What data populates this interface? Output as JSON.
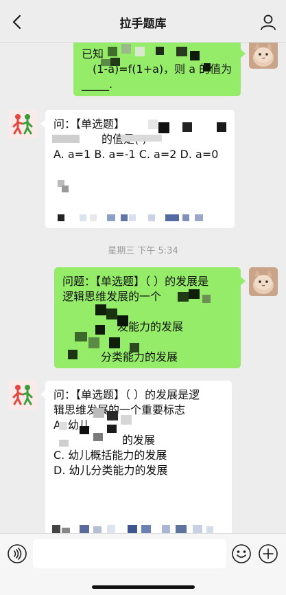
{
  "nav": {
    "title": "拉手题库"
  },
  "messages": {
    "m1": {
      "lines": [
        "已知",
        "(1-a)=f(1+a)，则 a 的值为",
        "_____."
      ]
    },
    "m2": {
      "lines": [
        "问：【单选题】",
        "的值是( )",
        "A. a=1 B. a=-1 C. a=2 D. a=0"
      ]
    },
    "timestamp": "星期三 下午 5:34",
    "m3": {
      "lines": [
        "问题：【单选题】（ ）的发展是",
        "逻辑思维发展的一个",
        "发能力的发展",
        "分类能力的发展"
      ]
    },
    "m4": {
      "lines": [
        "问：【单选题】（ ）的发展是逻",
        "辑思维发展的一个重要标志",
        "A. 幼儿",
        "的发展",
        "C. 幼儿概括能力的发展",
        "D. 幼儿分类能力的发展"
      ]
    }
  },
  "input": {
    "placeholder": ""
  },
  "colors": {
    "bubble_me": "#95ec69",
    "bubble_bot": "#ffffff",
    "background": "#ededed"
  },
  "icons": {
    "back": "chevron-left-icon",
    "user": "person-icon",
    "voice": "voice-icon",
    "emoji": "emoji-icon",
    "plus": "plus-icon"
  }
}
